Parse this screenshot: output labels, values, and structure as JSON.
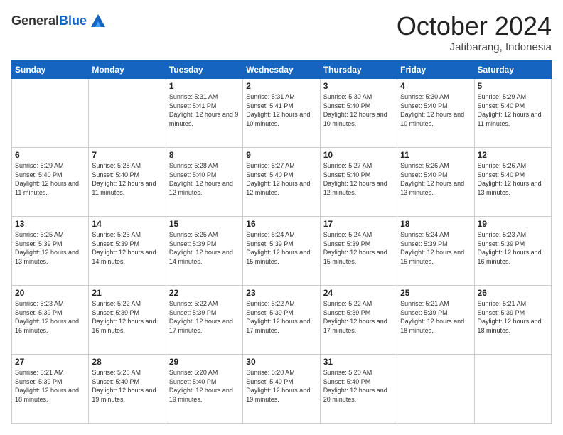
{
  "header": {
    "logo_line1": "General",
    "logo_line2": "Blue",
    "month": "October 2024",
    "location": "Jatibarang, Indonesia"
  },
  "weekdays": [
    "Sunday",
    "Monday",
    "Tuesday",
    "Wednesday",
    "Thursday",
    "Friday",
    "Saturday"
  ],
  "weeks": [
    [
      {
        "day": "",
        "info": ""
      },
      {
        "day": "",
        "info": ""
      },
      {
        "day": "1",
        "info": "Sunrise: 5:31 AM\nSunset: 5:41 PM\nDaylight: 12 hours and 9 minutes."
      },
      {
        "day": "2",
        "info": "Sunrise: 5:31 AM\nSunset: 5:41 PM\nDaylight: 12 hours and 10 minutes."
      },
      {
        "day": "3",
        "info": "Sunrise: 5:30 AM\nSunset: 5:40 PM\nDaylight: 12 hours and 10 minutes."
      },
      {
        "day": "4",
        "info": "Sunrise: 5:30 AM\nSunset: 5:40 PM\nDaylight: 12 hours and 10 minutes."
      },
      {
        "day": "5",
        "info": "Sunrise: 5:29 AM\nSunset: 5:40 PM\nDaylight: 12 hours and 11 minutes."
      }
    ],
    [
      {
        "day": "6",
        "info": "Sunrise: 5:29 AM\nSunset: 5:40 PM\nDaylight: 12 hours and 11 minutes."
      },
      {
        "day": "7",
        "info": "Sunrise: 5:28 AM\nSunset: 5:40 PM\nDaylight: 12 hours and 11 minutes."
      },
      {
        "day": "8",
        "info": "Sunrise: 5:28 AM\nSunset: 5:40 PM\nDaylight: 12 hours and 12 minutes."
      },
      {
        "day": "9",
        "info": "Sunrise: 5:27 AM\nSunset: 5:40 PM\nDaylight: 12 hours and 12 minutes."
      },
      {
        "day": "10",
        "info": "Sunrise: 5:27 AM\nSunset: 5:40 PM\nDaylight: 12 hours and 12 minutes."
      },
      {
        "day": "11",
        "info": "Sunrise: 5:26 AM\nSunset: 5:40 PM\nDaylight: 12 hours and 13 minutes."
      },
      {
        "day": "12",
        "info": "Sunrise: 5:26 AM\nSunset: 5:40 PM\nDaylight: 12 hours and 13 minutes."
      }
    ],
    [
      {
        "day": "13",
        "info": "Sunrise: 5:25 AM\nSunset: 5:39 PM\nDaylight: 12 hours and 13 minutes."
      },
      {
        "day": "14",
        "info": "Sunrise: 5:25 AM\nSunset: 5:39 PM\nDaylight: 12 hours and 14 minutes."
      },
      {
        "day": "15",
        "info": "Sunrise: 5:25 AM\nSunset: 5:39 PM\nDaylight: 12 hours and 14 minutes."
      },
      {
        "day": "16",
        "info": "Sunrise: 5:24 AM\nSunset: 5:39 PM\nDaylight: 12 hours and 15 minutes."
      },
      {
        "day": "17",
        "info": "Sunrise: 5:24 AM\nSunset: 5:39 PM\nDaylight: 12 hours and 15 minutes."
      },
      {
        "day": "18",
        "info": "Sunrise: 5:24 AM\nSunset: 5:39 PM\nDaylight: 12 hours and 15 minutes."
      },
      {
        "day": "19",
        "info": "Sunrise: 5:23 AM\nSunset: 5:39 PM\nDaylight: 12 hours and 16 minutes."
      }
    ],
    [
      {
        "day": "20",
        "info": "Sunrise: 5:23 AM\nSunset: 5:39 PM\nDaylight: 12 hours and 16 minutes."
      },
      {
        "day": "21",
        "info": "Sunrise: 5:22 AM\nSunset: 5:39 PM\nDaylight: 12 hours and 16 minutes."
      },
      {
        "day": "22",
        "info": "Sunrise: 5:22 AM\nSunset: 5:39 PM\nDaylight: 12 hours and 17 minutes."
      },
      {
        "day": "23",
        "info": "Sunrise: 5:22 AM\nSunset: 5:39 PM\nDaylight: 12 hours and 17 minutes."
      },
      {
        "day": "24",
        "info": "Sunrise: 5:22 AM\nSunset: 5:39 PM\nDaylight: 12 hours and 17 minutes."
      },
      {
        "day": "25",
        "info": "Sunrise: 5:21 AM\nSunset: 5:39 PM\nDaylight: 12 hours and 18 minutes."
      },
      {
        "day": "26",
        "info": "Sunrise: 5:21 AM\nSunset: 5:39 PM\nDaylight: 12 hours and 18 minutes."
      }
    ],
    [
      {
        "day": "27",
        "info": "Sunrise: 5:21 AM\nSunset: 5:39 PM\nDaylight: 12 hours and 18 minutes."
      },
      {
        "day": "28",
        "info": "Sunrise: 5:20 AM\nSunset: 5:40 PM\nDaylight: 12 hours and 19 minutes."
      },
      {
        "day": "29",
        "info": "Sunrise: 5:20 AM\nSunset: 5:40 PM\nDaylight: 12 hours and 19 minutes."
      },
      {
        "day": "30",
        "info": "Sunrise: 5:20 AM\nSunset: 5:40 PM\nDaylight: 12 hours and 19 minutes."
      },
      {
        "day": "31",
        "info": "Sunrise: 5:20 AM\nSunset: 5:40 PM\nDaylight: 12 hours and 20 minutes."
      },
      {
        "day": "",
        "info": ""
      },
      {
        "day": "",
        "info": ""
      }
    ]
  ]
}
